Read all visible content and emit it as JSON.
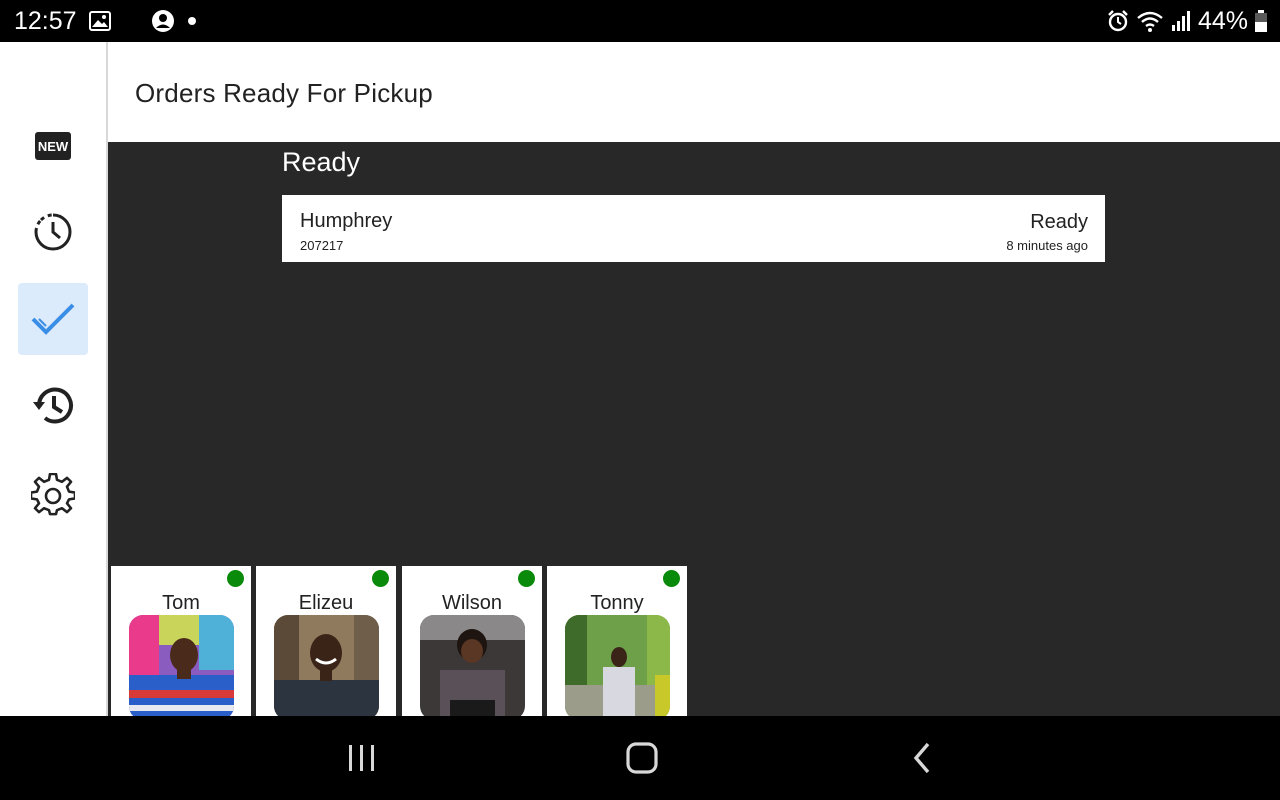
{
  "status_bar": {
    "time": "12:57",
    "battery": "44%",
    "left_icons": [
      "image-icon",
      "moon-icon",
      "account-circle-icon",
      "dot-icon"
    ],
    "right_icons": [
      "alarm-icon",
      "wifi-icon",
      "signal-icon",
      "battery-icon"
    ]
  },
  "sidebar": {
    "items": [
      {
        "name": "new-orders",
        "icon": "new-badge-icon",
        "icon_text": "NEW",
        "active": false
      },
      {
        "name": "pending",
        "icon": "clock-dashed-icon",
        "active": false
      },
      {
        "name": "ready",
        "icon": "check-icon",
        "active": true
      },
      {
        "name": "history",
        "icon": "history-icon",
        "active": false
      },
      {
        "name": "settings",
        "icon": "gear-icon",
        "active": false
      }
    ]
  },
  "header": {
    "title": "Orders Ready For Pickup"
  },
  "main": {
    "section_heading": "Ready",
    "orders": [
      {
        "customer": "Humphrey",
        "order_id": "207217",
        "status": "Ready",
        "time": "8 minutes ago"
      }
    ]
  },
  "staff": [
    {
      "name": "Tom",
      "online": true
    },
    {
      "name": "Elizeu",
      "online": true
    },
    {
      "name": "Wilson",
      "online": true
    },
    {
      "name": "Tonny",
      "online": true
    }
  ],
  "colors": {
    "accent": "#3a8ee6",
    "active_nav_bg": "#dcebfb",
    "main_bg": "#282828",
    "online": "#0a8a0a"
  },
  "navbar": {
    "buttons": [
      "recent-apps-icon",
      "home-icon",
      "back-icon"
    ]
  }
}
